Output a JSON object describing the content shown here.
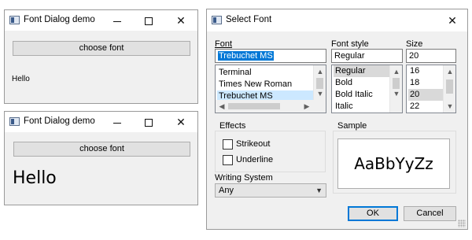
{
  "demo_windows": [
    {
      "title": "Font Dialog demo",
      "choose_font_label": "choose font",
      "output_text": "Hello"
    },
    {
      "title": "Font Dialog demo",
      "choose_font_label": "choose font",
      "output_text": "Hello"
    }
  ],
  "font_dialog": {
    "title": "Select Font",
    "close_glyph": "✕",
    "font": {
      "label": "Font",
      "value": "Trebuchet MS",
      "items": [
        "Terminal",
        "Times New Roman",
        "Trebuchet MS"
      ],
      "selected": "Trebuchet MS"
    },
    "style": {
      "label": "Font style",
      "value": "Regular",
      "items": [
        "Regular",
        "Bold",
        "Bold Italic",
        "Italic"
      ],
      "selected": "Regular"
    },
    "size": {
      "label": "Size",
      "value": "20",
      "items": [
        "16",
        "18",
        "20",
        "22"
      ],
      "selected": "20"
    },
    "effects": {
      "label": "Effects",
      "strikeout_label": "Strikeout",
      "underline_label": "Underline",
      "strikeout_checked": false,
      "underline_checked": false
    },
    "sample": {
      "label": "Sample",
      "text": "AaBbYyZz"
    },
    "writing_system": {
      "label": "Writing System",
      "value": "Any"
    },
    "ok_label": "OK",
    "cancel_label": "Cancel"
  },
  "icons": {
    "minimize": "minimize-icon",
    "maximize": "maximize-icon",
    "close": "close-icon",
    "scroll_up": "▲",
    "scroll_down": "▼",
    "scroll_left": "◀",
    "scroll_right": "▶",
    "dropdown": "▼"
  },
  "colors": {
    "selection_blue": "#0078d7",
    "list_selection": "#cce8ff",
    "window_bg": "#f0f0f0"
  }
}
